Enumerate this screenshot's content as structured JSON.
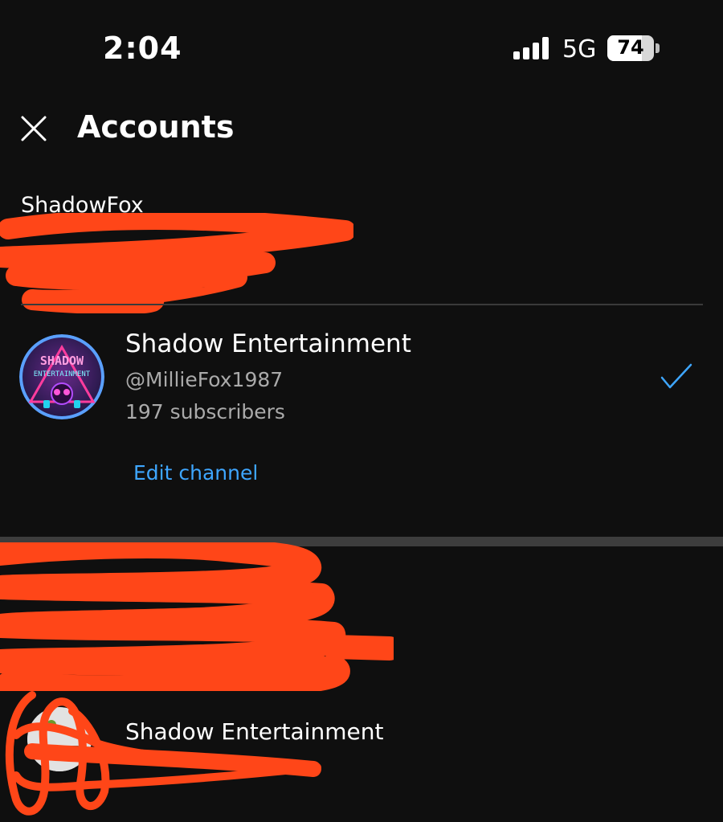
{
  "status_bar": {
    "time": "2:04",
    "network": "5G",
    "battery": "74",
    "battery_level": 0.74
  },
  "header": {
    "title": "Accounts",
    "close_icon": "close-icon"
  },
  "account": {
    "name": "ShadowFox"
  },
  "channel": {
    "name": "Shadow Entertainment",
    "handle": "@MillieFox1987",
    "subscribers": "197 subscribers",
    "edit_label": "Edit channel",
    "avatar_text_1": "SHADOW",
    "avatar_text_2": "ENTERTAINMENT",
    "selected_icon": "check-icon"
  },
  "second_account": {
    "channel_name": "Shadow Entertainment"
  },
  "colors": {
    "background": "#0f0f0f",
    "link": "#3ea6ff",
    "redaction": "#ff4618",
    "secondary_text": "#aaaaaa"
  }
}
